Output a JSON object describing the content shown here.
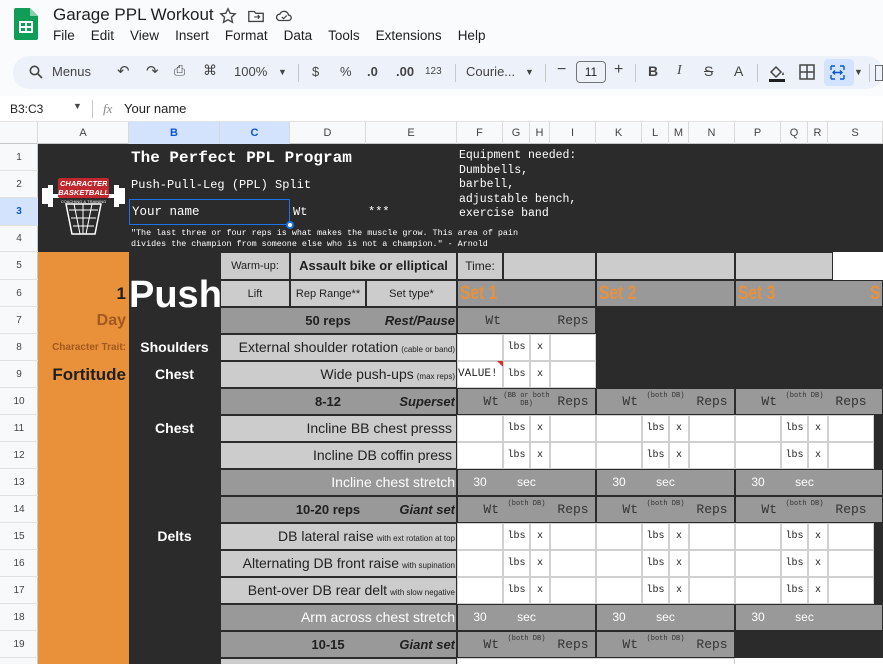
{
  "doc": {
    "title": "Garage PPL Workout"
  },
  "menu": [
    "File",
    "Edit",
    "View",
    "Insert",
    "Format",
    "Data",
    "Tools",
    "Extensions",
    "Help"
  ],
  "toolbar": {
    "menus": "Menus",
    "zoom": "100%",
    "currency": "$",
    "percent": "%",
    "dec_dec": ".0",
    "inc_dec": ".00",
    "num_fmt": "123",
    "font": "Courie...",
    "font_size": "11"
  },
  "formula": {
    "namebox": "B3:C3",
    "fx": "fx",
    "value": "Your name"
  },
  "columns": [
    "A",
    "B",
    "C",
    "D",
    "E",
    "F",
    "G",
    "H",
    "I",
    "K",
    "L",
    "M",
    "N",
    "P",
    "Q",
    "R",
    "S"
  ],
  "rows": [
    "1",
    "2",
    "3",
    "4",
    "5",
    "6",
    "7",
    "8",
    "9",
    "10",
    "11",
    "12",
    "13",
    "14",
    "15",
    "16",
    "17",
    "18",
    "19"
  ],
  "header": {
    "title": "The Perfect PPL Program",
    "subtitle": "Push-Pull-Leg (PPL) Split",
    "name": "Your name",
    "wt": "Wt",
    "stars": "***",
    "quote_1": "\"The last three or four reps is what makes the muscle grow. This area of pain",
    "quote_2": "divides the champion from someone else who is not a champion.\" - Arnold",
    "equip": [
      "Equipment needed:",
      "Dumbbells,",
      "barbell,",
      "adjustable bench,",
      "exercise band"
    ],
    "logo_top": "CHARACTER",
    "logo_mid": "BASKETBALL",
    "logo_bot": "COACHING & TRAINING"
  },
  "sidebar": {
    "day_num": "1",
    "day": "Day",
    "trait_label": "Character Trait:",
    "trait": "Fortitude"
  },
  "push": "Push",
  "row5": {
    "warmup": "Warm-up:",
    "warmup_val": "Assault bike or elliptical",
    "time": "Time:"
  },
  "row6": {
    "lift": "Lift",
    "rep_range": "Rep Range**",
    "set_type": "Set type*",
    "set1": "Set 1",
    "set2": "Set 2",
    "set3": "Set 3",
    "set4": "S"
  },
  "groups": {
    "shoulders": "Shoulders",
    "chest": "Chest",
    "chest2": "Chest",
    "delts": "Delts"
  },
  "blocks": {
    "b1": {
      "reps": "50 reps",
      "type": "Rest/Pause"
    },
    "b2": {
      "reps": "8-12",
      "type": "Superset"
    },
    "b3": {
      "reps": "10-20 reps",
      "type": "Giant set"
    },
    "b4": {
      "reps": "10-15",
      "type": "Giant set"
    }
  },
  "lifts": {
    "r8": {
      "name": "External shoulder rotation",
      "note": "(cable or band)"
    },
    "r9": {
      "name": "Wide push-ups",
      "note": "(max reps)"
    },
    "r11": {
      "name": "Incline BB chest presss",
      "note": ""
    },
    "r12": {
      "name": "Incline DB coffin press",
      "note": ""
    },
    "r13": {
      "name": "Incline chest stretch",
      "note": ""
    },
    "r15": {
      "name": "DB lateral raise",
      "note": "with ext rotation at top"
    },
    "r16": {
      "name": "Alternating DB front raise",
      "note": "with supination"
    },
    "r17": {
      "name": "Bent-over DB rear delt",
      "note": "with slow negative"
    },
    "r18": {
      "name": "Arm across chest stretch",
      "note": ""
    }
  },
  "cells": {
    "wt": "Wt",
    "reps": "Reps",
    "lbs": "lbs",
    "x": "x",
    "value_err": "VALUE!",
    "sec": "sec",
    "thirty": "30",
    "both_db": "(both DB)",
    "bb_or_db": "(BB or both DB)"
  }
}
